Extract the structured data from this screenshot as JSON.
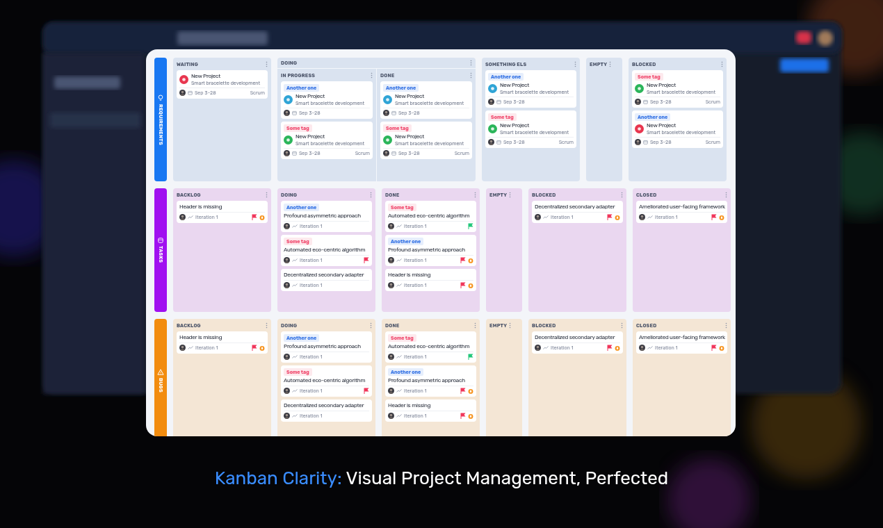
{
  "lanes": [
    {
      "name": "REQUIREMENTS",
      "color": "#1877f2",
      "columns": [
        {
          "title": "WAITING",
          "cards": [
            {
              "kind": "project",
              "icon": {
                "color": "#e8364f"
              },
              "title": "New Project",
              "subtitle": "Smart bracelette development",
              "date": "Sep 3–28",
              "method": "Scrum"
            }
          ]
        },
        {
          "title": "DOING",
          "subcolumns": [
            {
              "title": "IN PROGRESS",
              "cards": [
                {
                  "kind": "project",
                  "tag": {
                    "label": "Another one",
                    "color": "#2f6fe4"
                  },
                  "icon": {
                    "color": "#2fa4d6"
                  },
                  "title": "New Project",
                  "subtitle": "Smart bracelette development",
                  "date": "Sep 3–28"
                },
                {
                  "kind": "project",
                  "tag": {
                    "label": "Some tag",
                    "color": "#f0456a"
                  },
                  "icon": {
                    "color": "#2bb55a"
                  },
                  "title": "New Project",
                  "subtitle": "Smart bracelette development",
                  "date": "Sep 3–28",
                  "method": "Scrum"
                }
              ]
            },
            {
              "title": "DONE",
              "cards": [
                {
                  "kind": "project",
                  "tag": {
                    "label": "Another one",
                    "color": "#2f6fe4"
                  },
                  "icon": {
                    "color": "#2fa4d6"
                  },
                  "title": "New Project",
                  "subtitle": "Smart bracelette development",
                  "date": "Sep 3–28"
                },
                {
                  "kind": "project",
                  "tag": {
                    "label": "Some tag",
                    "color": "#f0456a"
                  },
                  "icon": {
                    "color": "#2bb55a"
                  },
                  "title": "New Project",
                  "subtitle": "Smart bracelette development",
                  "date": "Sep 3–28",
                  "method": "Scrum"
                }
              ]
            }
          ]
        },
        {
          "title": "SOMETHING ELS",
          "cards": [
            {
              "kind": "project",
              "tag": {
                "label": "Another one",
                "color": "#2f6fe4"
              },
              "icon": {
                "color": "#2fa4d6"
              },
              "title": "New Project",
              "subtitle": "Smart bracelette development",
              "date": "Sep 3–28"
            },
            {
              "kind": "project",
              "tag": {
                "label": "Some tag",
                "color": "#f0456a"
              },
              "icon": {
                "color": "#2bb55a"
              },
              "title": "New Project",
              "subtitle": "Smart bracelette development",
              "date": "Sep 3–28",
              "method": "Scrum"
            }
          ]
        },
        {
          "title": "EMPTY"
        },
        {
          "title": "BLOCKED",
          "cards": [
            {
              "kind": "project",
              "tag": {
                "label": "Some tag",
                "color": "#f0456a"
              },
              "icon": {
                "color": "#2bb55a"
              },
              "title": "New Project",
              "subtitle": "Smart bracelette development",
              "date": "Sep 3–28",
              "method": "Scrum"
            },
            {
              "kind": "project",
              "tag": {
                "label": "Another one",
                "color": "#2f6fe4"
              },
              "icon": {
                "color": "#e8364f"
              },
              "title": "New Project",
              "subtitle": "Smart bracelette development",
              "date": "Sep 3–28",
              "method": "Scrum"
            }
          ]
        }
      ]
    },
    {
      "name": "TASKS",
      "color": "#a010f0",
      "columns": [
        {
          "title": "BACKLOG",
          "cards": [
            {
              "kind": "task",
              "title": "Header is missing",
              "iteration": "Iteration 1",
              "flag": {
                "color": "#f0355a"
              },
              "fire": true
            }
          ]
        },
        {
          "title": "DOING",
          "cards": [
            {
              "kind": "task",
              "tag": {
                "label": "Another one",
                "color": "#2f6fe4"
              },
              "title": "Profound asymmetric approach",
              "iteration": "Iteration 1",
              "fire": false
            },
            {
              "kind": "task",
              "tag": {
                "label": "Some tag",
                "color": "#f0456a"
              },
              "title": "Automated eco-centric algorithm",
              "iteration": "Iteration 1",
              "flag": {
                "color": "#f0355a"
              },
              "fire": false
            },
            {
              "kind": "task",
              "title": "Decentralized secondary adapter",
              "iteration": "Iteration 1",
              "fire": false
            }
          ]
        },
        {
          "title": "DONE",
          "cards": [
            {
              "kind": "task",
              "tag": {
                "label": "Some tag",
                "color": "#f0456a"
              },
              "title": "Automated eco-centric algorithm",
              "iteration": "Iteration 1",
              "flag": {
                "color": "#22c77a"
              },
              "fire": false
            },
            {
              "kind": "task",
              "tag": {
                "label": "Another one",
                "color": "#2f6fe4"
              },
              "title": "Profound asymmetric approach",
              "iteration": "Iteration 1",
              "flag": {
                "color": "#f0355a"
              },
              "fire": true
            },
            {
              "kind": "task",
              "title": "Header is missing",
              "iteration": "Iteration 1",
              "flag": {
                "color": "#f0355a"
              },
              "fire": true
            }
          ]
        },
        {
          "title": "EMPTY"
        },
        {
          "title": "BLOCKED",
          "cards": [
            {
              "kind": "task",
              "title": "Decentralized secondary adapter",
              "iteration": "Iteration 1",
              "flag": {
                "color": "#f0355a"
              },
              "fire": true
            }
          ]
        },
        {
          "title": "CLOSED",
          "cards": [
            {
              "kind": "task",
              "title": "Ameliorated user-facing framework",
              "iteration": "Iteration 1",
              "flag": {
                "color": "#f0355a"
              },
              "fire": true
            }
          ]
        }
      ]
    },
    {
      "name": "BUGS",
      "color": "#f28c0f",
      "columns": [
        {
          "title": "BACKLOG",
          "cards": [
            {
              "kind": "task",
              "title": "Header is missing",
              "iteration": "Iteration 1",
              "flag": {
                "color": "#f0355a"
              },
              "fire": true
            }
          ]
        },
        {
          "title": "DOING",
          "cards": [
            {
              "kind": "task",
              "tag": {
                "label": "Another one",
                "color": "#2f6fe4"
              },
              "title": "Profound asymmetric approach",
              "iteration": "Iteration 1",
              "fire": false
            },
            {
              "kind": "task",
              "tag": {
                "label": "Some tag",
                "color": "#f0456a"
              },
              "title": "Automated eco-centric algorithm",
              "iteration": "Iteration 1",
              "flag": {
                "color": "#f0355a"
              },
              "fire": false
            },
            {
              "kind": "task",
              "title": "Decentralized secondary adapter",
              "iteration": "Iteration 1",
              "fire": false
            }
          ]
        },
        {
          "title": "DONE",
          "cards": [
            {
              "kind": "task",
              "tag": {
                "label": "Some tag",
                "color": "#f0456a"
              },
              "title": "Automated eco-centric algorithm",
              "iteration": "Iteration 1",
              "flag": {
                "color": "#22c77a"
              },
              "fire": false
            },
            {
              "kind": "task",
              "tag": {
                "label": "Another one",
                "color": "#2f6fe4"
              },
              "title": "Profound asymmetric approach",
              "iteration": "Iteration 1",
              "flag": {
                "color": "#f0355a"
              },
              "fire": true
            },
            {
              "kind": "task",
              "title": "Header is missing",
              "iteration": "Iteration 1",
              "flag": {
                "color": "#f0355a"
              },
              "fire": true
            }
          ]
        },
        {
          "title": "EMPTY"
        },
        {
          "title": "BLOCKED",
          "cards": [
            {
              "kind": "task",
              "title": "Decentralized secondary adapter",
              "iteration": "Iteration 1",
              "flag": {
                "color": "#f0355a"
              },
              "fire": true
            }
          ]
        },
        {
          "title": "CLOSED",
          "cards": [
            {
              "kind": "task",
              "title": "Ameliorated user-facing framework",
              "iteration": "Iteration 1",
              "flag": {
                "color": "#f0355a"
              },
              "fire": true
            }
          ]
        }
      ]
    }
  ],
  "caption": {
    "highlight": "Kanban Clarity:",
    "text": "Visual Project Management, Perfected"
  }
}
